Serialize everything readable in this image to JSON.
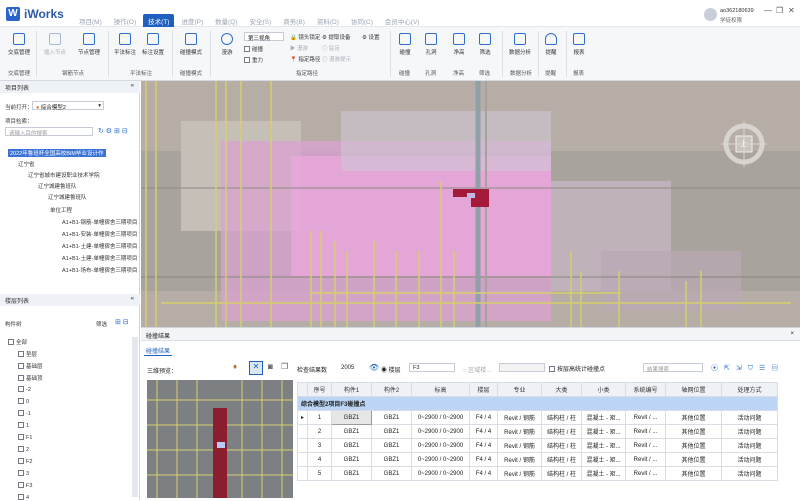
{
  "app": {
    "logo_letter": "W",
    "name": "iWorks"
  },
  "menu": [
    "项目(M)",
    "操作(O)",
    "技术(T)",
    "进度(P)",
    "数量(Q)",
    "安全(S)",
    "商务(B)",
    "资料(D)",
    "协同(C)",
    "会员中心(V)"
  ],
  "user": {
    "name": "ao362180639",
    "role": "学徒权限"
  },
  "window_controls": [
    "—",
    "❐",
    "✕"
  ],
  "ribbon": {
    "buttons": [
      {
        "label": "交底管理",
        "disabled": false
      },
      {
        "label": "插入节点",
        "disabled": true
      },
      {
        "label": "节点管理",
        "disabled": false
      },
      {
        "label": "平法标注",
        "disabled": false
      },
      {
        "label": "标注设置",
        "disabled": false
      },
      {
        "label": "碰撞模式",
        "disabled": false
      },
      {
        "label": "漫游",
        "disabled": false
      },
      {
        "label": "碰撞",
        "disabled": false
      },
      {
        "label": "孔洞",
        "disabled": false
      },
      {
        "label": "净高",
        "disabled": false
      },
      {
        "label": "筛选",
        "disabled": false
      },
      {
        "label": "数据分析",
        "disabled": false
      },
      {
        "label": "提醒",
        "disabled": false
      },
      {
        "label": "报表",
        "disabled": false
      }
    ],
    "view_select": "第三视角",
    "small_items": [
      "碰撞",
      "重力",
      "镜头锁定",
      "漫游",
      "指定路径",
      "提取设备",
      "驻足",
      "漫游提示",
      "设置"
    ],
    "groups": [
      "交底管理",
      "钢筋节点",
      "平法标注",
      "碰撞模式",
      "指定路径",
      "碰撞",
      "孔洞",
      "净高",
      "筛选",
      "数据分析",
      "提醒",
      "报表"
    ]
  },
  "left": {
    "project_panel_title": "项目列表",
    "current_open_label": "当前打开：",
    "current_open_value": "综合模型2",
    "project_lookup_label": "项目检索：",
    "search_placeholder": "请输入目的搜索",
    "tree": [
      "2022年鲁班杯全国高校BIM毕业设计作",
      "辽宁省",
      "辽宁省城市建设职业技术学院",
      "辽宁城建鲁班队",
      "辽宁城建鲁班队",
      "单位工程",
      "A1+B1-钢筋-单幢宿舍三期项目",
      "A1+B1-安装-单幢宿舍三期项目",
      "A1+B1-土建-单幢宿舍三期项目",
      "A1+B1-土建-单幢宿舍三期项目",
      "A1+B1-场布-单幢宿舍三期项目"
    ],
    "floor_panel_title": "楼层列表",
    "component_tree_label": "构件树",
    "filter_label": "筛选",
    "floors": [
      "全部",
      "垫层",
      "基础层",
      "基础顶",
      "-2",
      "0",
      "-1",
      "1",
      "F1",
      "2",
      "F2",
      "3",
      "F3",
      "4"
    ]
  },
  "viewport": {
    "compass_label": "上"
  },
  "results": {
    "panel_title": "碰撞结果",
    "tab": "碰撞结果",
    "preview_label": "三维预览：",
    "count_label": "检查结果数",
    "count_value": "2005",
    "floor_radio": "楼层",
    "floor_value": "F3",
    "region_placeholder": "区域楼...",
    "checkbox_label": "按层高统计碰撞点",
    "search_placeholder": "结果搜索",
    "group_row": "综合模型2项目F3碰撞点",
    "columns": [
      "序号",
      "构件1",
      "构件2",
      "标高",
      "楼层",
      "专业",
      "大类",
      "小类",
      "系统编号",
      "轴网位置",
      "处理方式"
    ],
    "rows": [
      [
        "1",
        "GBZ1",
        "GBZ1",
        "0~2900 / 0~2900",
        "F4 / 4",
        "Revit / 钢筋",
        "结构柱 / 柱",
        "混凝土 - 矩...",
        "Revit / ...",
        "其他位置",
        "活动问题"
      ],
      [
        "2",
        "GBZ1",
        "GBZ1",
        "0~2900 / 0~2900",
        "F4 / 4",
        "Revit / 钢筋",
        "结构柱 / 柱",
        "混凝土 - 矩...",
        "Revit / ...",
        "其他位置",
        "活动问题"
      ],
      [
        "3",
        "GBZ1",
        "GBZ1",
        "0~2900 / 0~2900",
        "F4 / 4",
        "Revit / 钢筋",
        "结构柱 / 柱",
        "混凝土 - 矩...",
        "Revit / ...",
        "其他位置",
        "活动问题"
      ],
      [
        "4",
        "GBZ1",
        "GBZ1",
        "0~2900 / 0~2900",
        "F4 / 4",
        "Revit / 钢筋",
        "结构柱 / 柱",
        "混凝土 - 矩...",
        "Revit / ...",
        "其他位置",
        "活动问题"
      ],
      [
        "5",
        "GBZ1",
        "GBZ1",
        "0~2900 / 0~2900",
        "F4 / 4",
        "Revit / 钢筋",
        "结构柱 / 柱",
        "混凝土 - 矩...",
        "Revit / ...",
        "其他位置",
        "活动问题"
      ]
    ]
  },
  "colors": {
    "accent": "#1f5fbf",
    "clash": "#a5193a",
    "pink": "#e8a2d8"
  }
}
